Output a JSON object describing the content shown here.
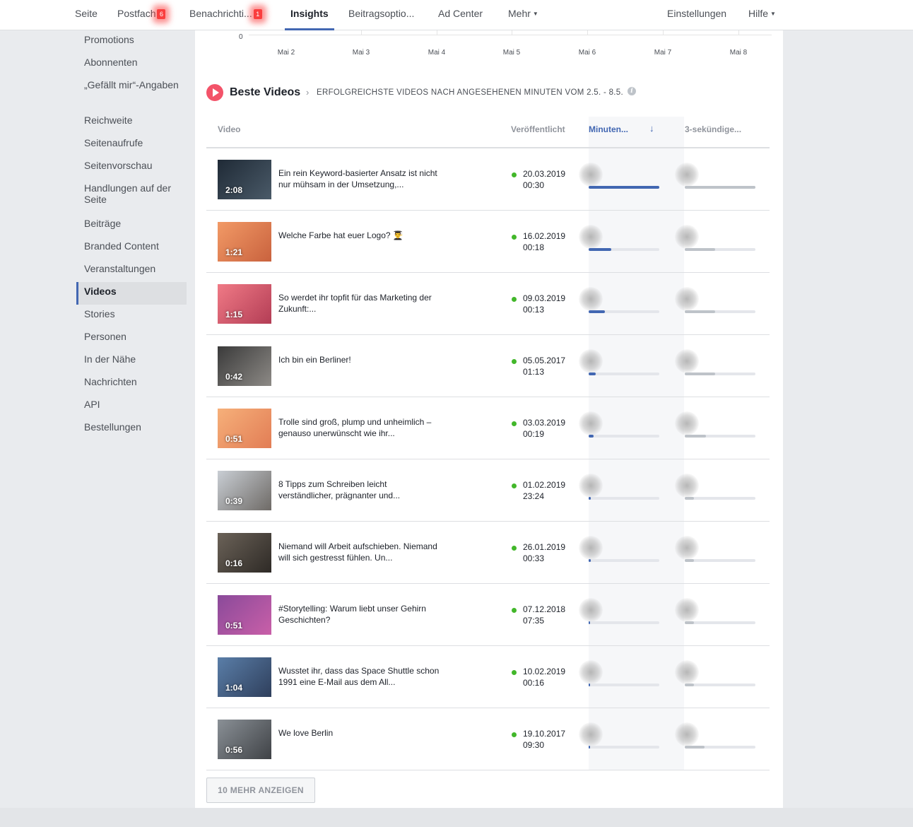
{
  "nav": {
    "items": [
      {
        "label": "Seite"
      },
      {
        "label": "Postfach",
        "badge": "6"
      },
      {
        "label": "Benachrichti...",
        "badge": "1"
      },
      {
        "label": "Insights",
        "active": true
      },
      {
        "label": "Beitragsoptio..."
      },
      {
        "label": "Ad Center"
      },
      {
        "label": "Mehr",
        "dropdown": true
      }
    ],
    "right": [
      {
        "label": "Einstellungen"
      },
      {
        "label": "Hilfe",
        "dropdown": true
      }
    ]
  },
  "sidebar": {
    "items": [
      {
        "label": "Promotions"
      },
      {
        "label": "Abonnenten"
      },
      {
        "label": "„Gefällt mir“-Angaben"
      },
      {
        "label": "Reichweite"
      },
      {
        "label": "Seitenaufrufe"
      },
      {
        "label": "Seitenvorschau"
      },
      {
        "label": "Handlungen auf der Seite"
      },
      {
        "label": "Beiträge"
      },
      {
        "label": "Branded Content"
      },
      {
        "label": "Veranstaltungen"
      },
      {
        "label": "Videos",
        "active": true
      },
      {
        "label": "Stories"
      },
      {
        "label": "Personen"
      },
      {
        "label": "In der Nähe"
      },
      {
        "label": "Nachrichten"
      },
      {
        "label": "API"
      },
      {
        "label": "Bestellungen"
      }
    ]
  },
  "chart_axis": {
    "zero": "0",
    "ticks": [
      "Mai 2",
      "Mai 3",
      "Mai 4",
      "Mai 5",
      "Mai 6",
      "Mai 7",
      "Mai 8"
    ]
  },
  "top_videos": {
    "title": "Beste Videos",
    "subtitle": "ERFOLGREICHSTE VIDEOS NACH ANGESEHENEN MINUTEN VOM 2.5. - 8.5.",
    "columns": {
      "video": "Video",
      "published": "Veröffentlicht",
      "minutes": "Minuten...",
      "three_sec": "3-sekündige..."
    },
    "rows": [
      {
        "duration": "2:08",
        "title": "Ein rein Keyword-basierter Ansatz ist nicht nur mühsam in der Umsetzung,...",
        "date": "20.03.2019",
        "time": "00:30",
        "minutes_fill": 1.0,
        "views_fill": 1.0,
        "thumb": [
          "#1f2a36",
          "#4a5a68"
        ]
      },
      {
        "duration": "1:21",
        "title": "Welche Farbe hat euer Logo? 👨‍🎓",
        "date": "16.02.2019",
        "time": "00:18",
        "minutes_fill": 0.32,
        "views_fill": 0.43,
        "thumb": [
          "#f29a66",
          "#c9623e"
        ]
      },
      {
        "duration": "1:15",
        "title": "So werdet ihr topfit für das Marketing der Zukunft:...",
        "date": "09.03.2019",
        "time": "00:13",
        "minutes_fill": 0.23,
        "views_fill": 0.43,
        "thumb": [
          "#f07a86",
          "#b33d55"
        ]
      },
      {
        "duration": "0:42",
        "title": "Ich bin ein Berliner!",
        "date": "05.05.2017",
        "time": "01:13",
        "minutes_fill": 0.1,
        "views_fill": 0.43,
        "thumb": [
          "#3a3a3a",
          "#8d8a86"
        ]
      },
      {
        "duration": "0:51",
        "title": "Trolle sind groß, plump und unheimlich – genauso unerwünscht wie ihr...",
        "date": "03.03.2019",
        "time": "00:19",
        "minutes_fill": 0.07,
        "views_fill": 0.3,
        "thumb": [
          "#f6b07a",
          "#e27d55"
        ]
      },
      {
        "duration": "0:39",
        "title": "8 Tipps zum Schreiben leicht verständlicher, prägnanter und...",
        "date": "01.02.2019",
        "time": "23:24",
        "minutes_fill": 0.03,
        "views_fill": 0.13,
        "thumb": [
          "#c9ced4",
          "#6e6a66"
        ]
      },
      {
        "duration": "0:16",
        "title": "Niemand will Arbeit aufschieben. Niemand will sich gestresst fühlen. Un...",
        "date": "26.01.2019",
        "time": "00:33",
        "minutes_fill": 0.03,
        "views_fill": 0.13,
        "thumb": [
          "#6b6258",
          "#2e2a26"
        ]
      },
      {
        "duration": "0:51",
        "title": "#Storytelling: Warum liebt unser Gehirn Geschichten?",
        "date": "07.12.2018",
        "time": "07:35",
        "minutes_fill": 0.02,
        "views_fill": 0.13,
        "thumb": [
          "#8a4a9a",
          "#c95fa8"
        ]
      },
      {
        "duration": "1:04",
        "title": "Wusstet ihr, dass das Space Shuttle schon 1991 eine E-Mail aus dem All...",
        "date": "10.02.2019",
        "time": "00:16",
        "minutes_fill": 0.02,
        "views_fill": 0.13,
        "thumb": [
          "#5a7ea8",
          "#2f3f5c"
        ]
      },
      {
        "duration": "0:56",
        "title": "We love Berlin",
        "date": "19.10.2017",
        "time": "09:30",
        "minutes_fill": 0.02,
        "views_fill": 0.28,
        "thumb": [
          "#8a9096",
          "#3f4246"
        ]
      }
    ],
    "more_button": "10 MEHR ANZEIGEN"
  },
  "colors": {
    "accent": "#4267b2",
    "badge": "#fa3e3e",
    "published_dot": "#42b72a",
    "play_icon": "#f35369"
  }
}
